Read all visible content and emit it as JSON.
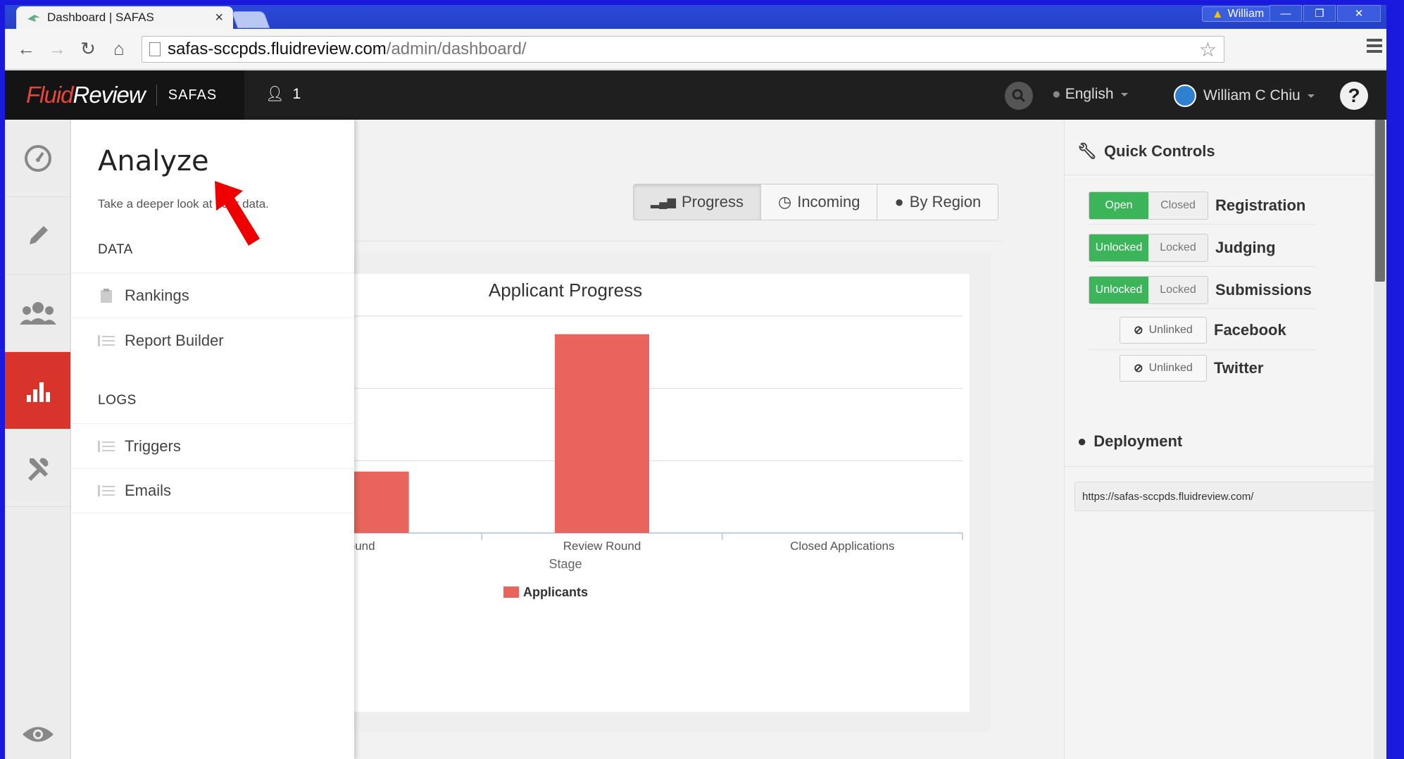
{
  "browser": {
    "tab_title": "Dashboard | SAFAS",
    "tab_close": "×",
    "profile_name": "William",
    "url_host": "safas-sccpds.fluidreview.com",
    "url_path": "/admin/dashboard/",
    "window_buttons": [
      "—",
      "❐",
      "✕"
    ]
  },
  "appnav": {
    "logo_fluid": "Fluid",
    "logo_review": "Review",
    "org": "SAFAS",
    "user_count": "1",
    "language": "English",
    "user_name": "William C Chiu",
    "help": "?"
  },
  "flyout": {
    "title": "Analyze",
    "subtitle": "Take a deeper look at your data.",
    "section_data": "DATA",
    "rankings": "Rankings",
    "report_builder": "Report Builder",
    "section_logs": "LOGS",
    "triggers": "Triggers",
    "emails": "Emails"
  },
  "tabs": [
    "Progress",
    "Incoming",
    "By Region"
  ],
  "chart_data": {
    "type": "bar",
    "title": "Applicant Progress",
    "xlabel": "Stage",
    "ylabel": "",
    "categories": [
      "Eligibility Round",
      "Review Round",
      "Closed Applications"
    ],
    "series": [
      {
        "name": "Applicants",
        "values": [
          0.85,
          2.75,
          0
        ]
      }
    ],
    "ylim": [
      0,
      3
    ],
    "grid": true,
    "legend": "bottom",
    "bar_color": "#e8645c",
    "visible_category_labels": [
      "ound",
      "Review Round",
      "Closed Applications"
    ]
  },
  "quick_controls": {
    "title": "Quick Controls",
    "rows": [
      {
        "on": "Open",
        "off": "Closed",
        "label": "Registration"
      },
      {
        "on": "Unlocked",
        "off": "Locked",
        "label": "Judging"
      },
      {
        "on": "Unlocked",
        "off": "Locked",
        "label": "Submissions"
      }
    ],
    "social": [
      {
        "state": "Unlinked",
        "label": "Facebook"
      },
      {
        "state": "Unlinked",
        "label": "Twitter"
      }
    ]
  },
  "deployment": {
    "title": "Deployment",
    "url": "https://safas-sccpds.fluidreview.com/"
  },
  "colors": {
    "accent_red": "#d9342b",
    "toggle_green": "#3cb55a",
    "bar": "#e8645c"
  }
}
